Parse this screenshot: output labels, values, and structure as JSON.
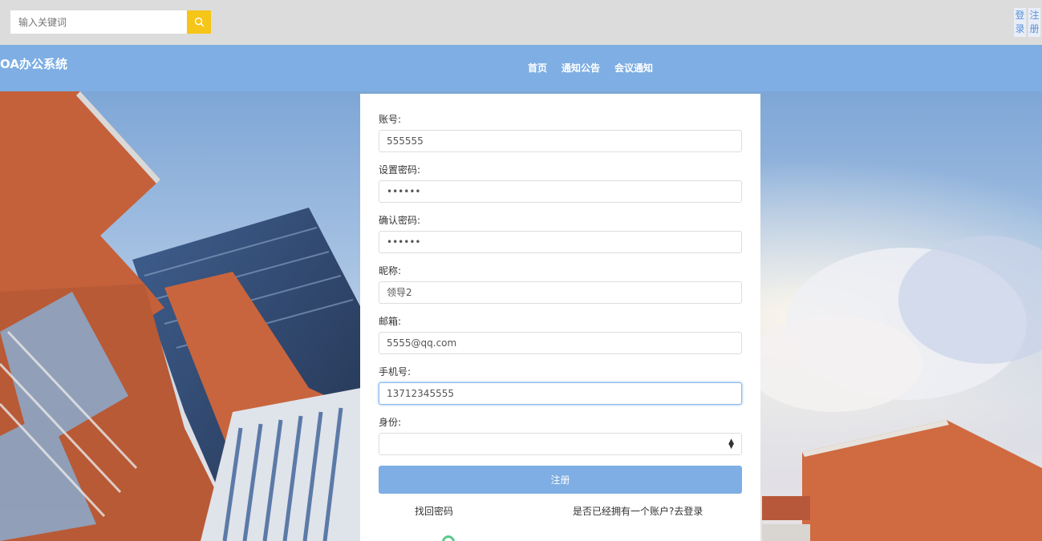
{
  "search": {
    "placeholder": "输入关键词"
  },
  "auth": {
    "login": "登录",
    "register": "注册"
  },
  "brand": "OA办公系统",
  "nav": [
    {
      "label": "首页"
    },
    {
      "label": "通知公告"
    },
    {
      "label": "会议通知"
    }
  ],
  "form": {
    "fields": [
      {
        "label": "账号:",
        "value": "555555"
      },
      {
        "label": "设置密码:",
        "value": "••••••"
      },
      {
        "label": "确认密码:",
        "value": "••••••"
      },
      {
        "label": "昵称:",
        "value": "领导2"
      },
      {
        "label": "邮箱:",
        "value": "5555@qq.com"
      },
      {
        "label": "手机号:",
        "value": "13712345555"
      },
      {
        "label": "身份:",
        "value": ""
      }
    ],
    "submit": "注册",
    "find_password": "找回密码",
    "have_account": "是否已经拥有一个账户?去登录"
  },
  "colors": {
    "accent": "#7eaee3",
    "search_button": "#f5c518",
    "topbar": "#dcdcdc"
  }
}
